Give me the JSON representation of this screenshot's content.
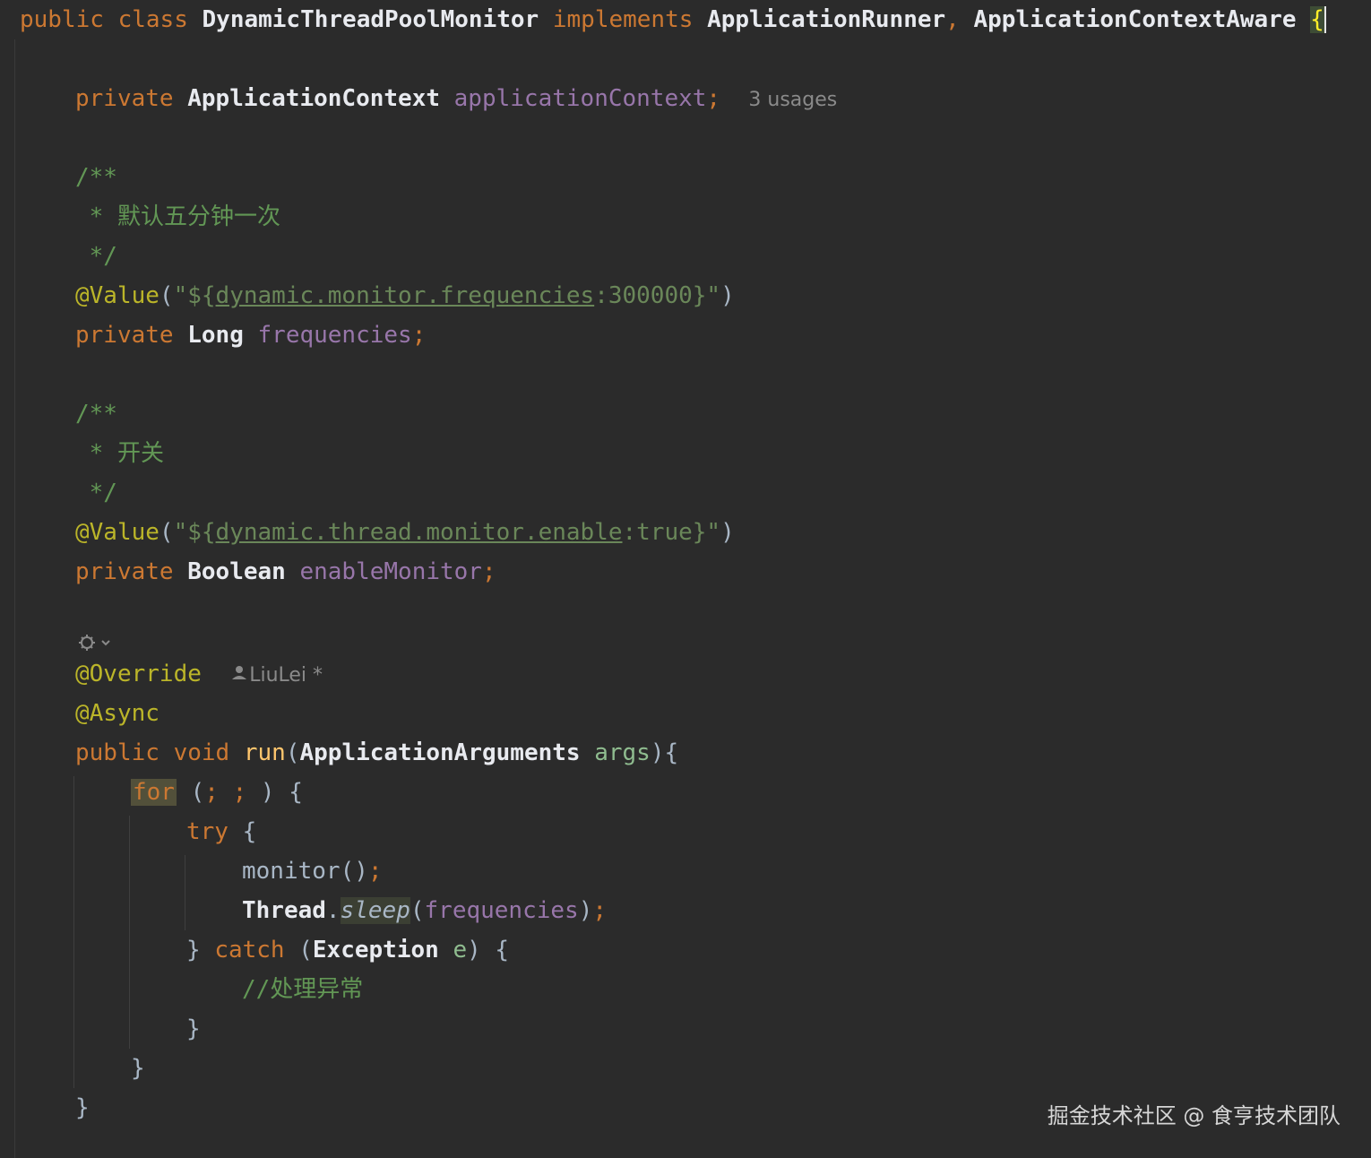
{
  "code": {
    "l1": {
      "kw1": "public",
      "kw2": "class",
      "class_name": "DynamicThreadPoolMonitor",
      "kw3": "implements",
      "iface1": "ApplicationRunner",
      "comma": ",",
      "iface2": "ApplicationContextAware",
      "brace": "{"
    },
    "l2": {
      "kw": "private",
      "type": "ApplicationContext",
      "field": "applicationContext",
      "semi": ";",
      "hint": "3 usages"
    },
    "doc1": {
      "open": "/**",
      "body": " * 默认五分钟一次",
      "close": " */"
    },
    "l3": {
      "ann": "@Value",
      "p1": "(",
      "s1": "\"${",
      "prop": "dynamic.monitor.frequencies",
      "s2": ":300000}\"",
      "p2": ")"
    },
    "l4": {
      "kw": "private",
      "type": "Long",
      "field": "frequencies",
      "semi": ";"
    },
    "doc2": {
      "open": "/**",
      "body": " * 开关",
      "close": " */"
    },
    "l5": {
      "ann": "@Value",
      "p1": "(",
      "s1": "\"${",
      "prop": "dynamic.thread.monitor.enable",
      "s2": ":true}\"",
      "p2": ")"
    },
    "l6": {
      "kw": "private",
      "type": "Boolean",
      "field": "enableMonitor",
      "semi": ";"
    },
    "l7": {
      "ann": "@Override",
      "author": "LiuLei *"
    },
    "l8": {
      "ann": "@Async"
    },
    "l9": {
      "kw1": "public",
      "kw2": "void",
      "method": "run",
      "p1": "(",
      "type": "ApplicationArguments",
      "param": "args",
      "p2": "){"
    },
    "l10": {
      "kw": "for",
      "rest1": " (",
      "semi1": ";",
      "sp": " ",
      "semi2": ";",
      "rest2": " ) {"
    },
    "l11": {
      "kw": "try",
      "rest": " {"
    },
    "l12": {
      "call": "monitor()",
      "semi": ";"
    },
    "l13": {
      "type": "Thread",
      "dot": ".",
      "method": "sleep",
      "p1": "(",
      "field": "frequencies",
      "p2": ")",
      "semi": ";"
    },
    "l14": {
      "close": "} ",
      "kw": "catch",
      "p1": " (",
      "type": "Exception",
      "param": " e",
      "p2": ") {"
    },
    "l15": {
      "comment": "//处理异常"
    },
    "l16": {
      "brace": "}"
    },
    "l17": {
      "brace": "}"
    },
    "l18": {
      "brace": "}"
    }
  },
  "watermark": "掘金技术社区 @ 食亨技术团队",
  "icons": {
    "gear": "ai-assist-icon",
    "user": "user-icon"
  },
  "colors": {
    "background": "#2b2b2b",
    "keyword": "#cc7832",
    "field": "#9876aa",
    "annotation": "#bbb529",
    "string": "#6a8759",
    "doc": "#629755",
    "method": "#ffc66d"
  }
}
